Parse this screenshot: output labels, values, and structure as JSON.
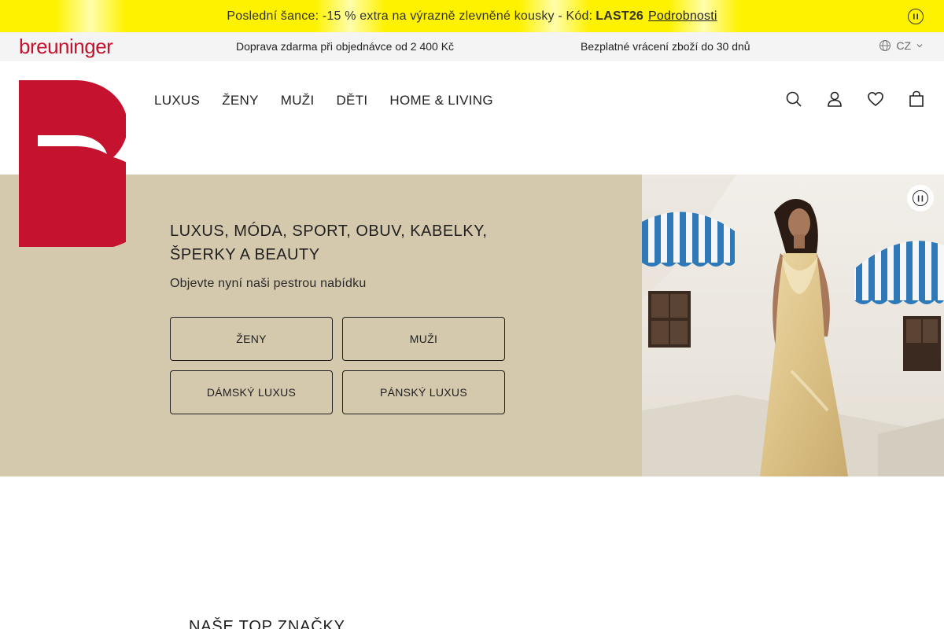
{
  "promo": {
    "text": "Poslední šance: -15 % extra na výrazně zlevněné kousky - Kód:",
    "code": "LAST26",
    "link": "Podrobnosti",
    "pause_icon": "pause-circle-icon",
    "color": "#fff200"
  },
  "service": {
    "logo": "breuninger",
    "shipping": "Doprava zdarma při objednávce od 2 400 Kč",
    "returns": "Bezplatné vrácení zboží do 30 dnů",
    "language": "CZ",
    "language_icon": "globe-icon"
  },
  "nav": {
    "items": [
      "LUXUS",
      "ŽENY",
      "MUŽI",
      "DĚTI",
      "HOME & LIVING"
    ]
  },
  "header_icons": [
    "search-icon",
    "account-icon",
    "wishlist-heart-icon",
    "shopping-bag-icon"
  ],
  "brand_color": "#c4122f",
  "hero": {
    "title": "LUXUS, MÓDA, SPORT, OBUV, KABELKY, ŠPERKY A BEAUTY",
    "subtitle": "Objevte nyní naši pestrou nabídku",
    "buttons": [
      "ŽENY",
      "MUŽI",
      "DÁMSKÝ LUXUS",
      "PÁNSKÝ LUXUS"
    ],
    "background": "#d5c9ad",
    "pause_icon": "pause-circle-icon"
  },
  "brands": {
    "title": "NAŠE TOP ZNAČKY"
  }
}
